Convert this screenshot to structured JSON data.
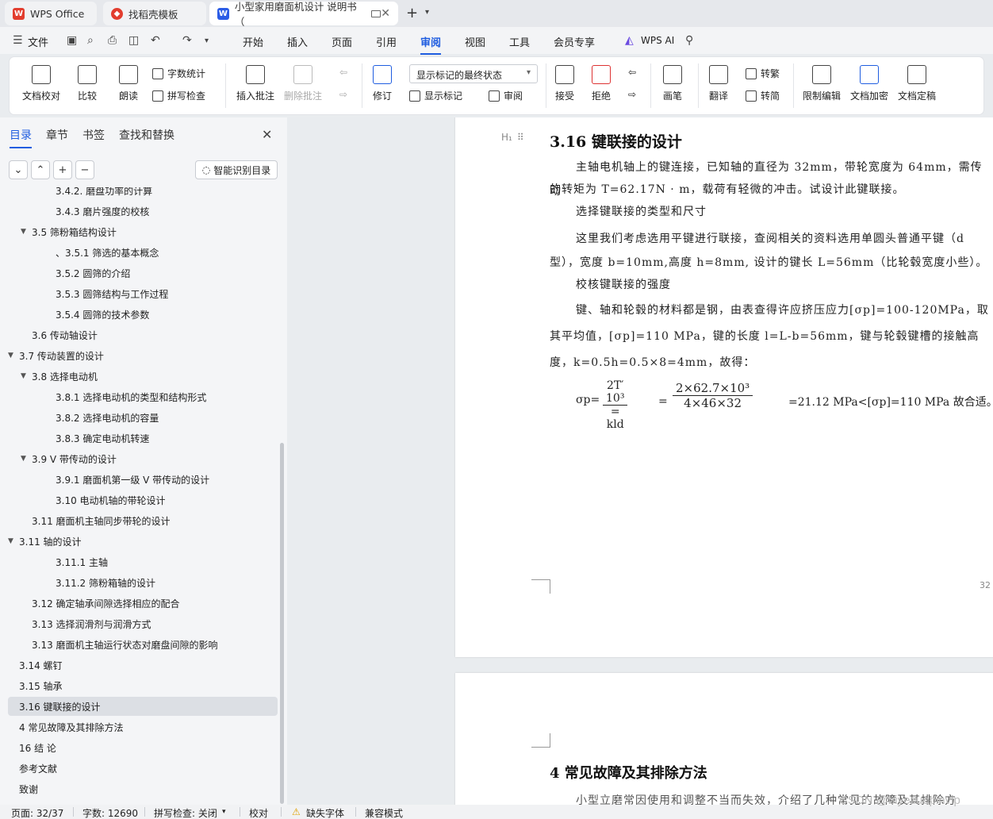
{
  "tabs": {
    "wps_office": "WPS Office",
    "template": "找稻壳模板",
    "document": "小型家用磨面机设计 说明书（"
  },
  "menu": {
    "file": "文件",
    "start": "开始",
    "insert": "插入",
    "page": "页面",
    "cite": "引用",
    "review": "审阅",
    "view": "视图",
    "tools": "工具",
    "member": "会员专享",
    "wps_ai": "WPS AI"
  },
  "ribbon": {
    "doc_check": "文档校对",
    "compare": "比较",
    "read": "朗读",
    "word_count": "字数统计",
    "spell_check": "拼写检查",
    "insert_comment": "插入批注",
    "delete_comment": "删除批注",
    "revise": "修订",
    "display_mode": "显示标记的最终状态",
    "show_marks": "显示标记",
    "review_pane": "审阅",
    "accept": "接受",
    "reject": "拒绝",
    "pen": "画笔",
    "translate": "翻译",
    "to_traditional": "转繁",
    "to_simplified": "转简",
    "restrict_edit": "限制编辑",
    "encrypt": "文档加密",
    "finalize": "文档定稿"
  },
  "panel": {
    "tabs": [
      "目录",
      "章节",
      "书签",
      "查找和替换"
    ],
    "smart_toc": "智能识别目录",
    "toc": [
      {
        "label": "3.4.2. 磨盘功率的计算",
        "level": 3
      },
      {
        "label": "3.4.3 磨片强度的校核",
        "level": 3
      },
      {
        "label": "3.5  筛粉箱结构设计",
        "level": 2,
        "expanded": true
      },
      {
        "label": "、3.5.1  筛选的基本概念",
        "level": 3
      },
      {
        "label": "3.5.2 圆筛的介绍",
        "level": 3
      },
      {
        "label": "3.5.3  圆筛结构与工作过程",
        "level": 3
      },
      {
        "label": "3.5.4  圆筛的技术参数",
        "level": 3
      },
      {
        "label": "3.6  传动轴设计",
        "level": 2
      },
      {
        "label": "3.7  传动装置的设计",
        "level": 1,
        "expanded": true
      },
      {
        "label": "3.8  选择电动机",
        "level": 2,
        "expanded": true
      },
      {
        "label": "3.8.1  选择电动机的类型和结构形式",
        "level": 3
      },
      {
        "label": "3.8.2  选择电动机的容量",
        "level": 3
      },
      {
        "label": "3.8.3  确定电动机转速",
        "level": 3
      },
      {
        "label": "3.9 V 带传动的设计",
        "level": 2,
        "expanded": true
      },
      {
        "label": "3.9.1  磨面机第一级 V 带传动的设计",
        "level": 3
      },
      {
        "label": "3.10 电动机轴的带轮设计",
        "level": 3
      },
      {
        "label": "3.11  磨面机主轴同步带轮的设计",
        "level": 2
      },
      {
        "label": "3.11  轴的设计",
        "level": 1,
        "expanded": true
      },
      {
        "label": "3.11.1  主轴",
        "level": 3
      },
      {
        "label": "3.11.2  筛粉箱轴的设计",
        "level": 3
      },
      {
        "label": "3.12  确定轴承间隙选择相应的配合",
        "level": 2
      },
      {
        "label": "3.13 选择润滑剂与润滑方式",
        "level": 2
      },
      {
        "label": "3.13  磨面机主轴运行状态对磨盘间隙的影响",
        "level": 2
      },
      {
        "label": "3.14  螺钉",
        "level": 1
      },
      {
        "label": "3.15 轴承",
        "level": 1
      },
      {
        "label": "3.16    键联接的设计",
        "level": 1,
        "selected": true
      },
      {
        "label": "4  常见故障及其排除方法",
        "level": 1
      },
      {
        "label": "16  结  论",
        "level": 1
      },
      {
        "label": "参考文献",
        "level": 1
      },
      {
        "label": "致谢",
        "level": 1
      }
    ]
  },
  "document": {
    "heading": "3.16   键联接的设计",
    "para1_line1": "主轴电机轴上的键连接，已知轴的直径为 32mm，带轮宽度为 64mm，需传动",
    "para1_line2": "的转矩为 T=62.17N · m，载荷有轻微的冲击。试设计此键联接。",
    "para2": "选择键联接的类型和尺寸",
    "para3_line1": "这里我们考虑选用平键进行联接，查阅相关的资料选用单圆头普通平键（d",
    "para3_line2": "型），宽度 b=10mm,高度 h=8mm, 设计的键长 L=56mm（比轮毂宽度小些）。",
    "para4": "校核键联接的强度",
    "para5_line1": "键、轴和轮毂的材料都是钢，由表查得许应挤压应力[σp]=100-120MPa，取",
    "para5_line2": "其平均值，[σp]=110 MPa，键的长度 l=L-b=56mm，键与轮毂键槽的接触高",
    "para5_line3": "度，k=0.5h=0.5×8=4mm，故得：",
    "formula_lhs": "σp=",
    "formula_num1": "2T′ 10³",
    "formula_den1": "= kld",
    "formula_eq": "=",
    "formula_num2": "2×62.7×10³",
    "formula_den2": "4×46×32",
    "formula_result": "=21.12 MPa<[σp]=110 MPa 故合适。",
    "page_number": "32",
    "heading2": "4  常见故障及其排除方法",
    "para_next": "小型立磨常因使用和调整不当而失效，介绍了几种常见的故障及其排除方"
  },
  "status": {
    "page": "页面: 32/37",
    "words": "字数: 12690",
    "spell": "拼写检查: 关闭",
    "proof": "校对",
    "missing_font": "缺失字体",
    "compat": "兼容模式"
  },
  "watermark": "CSDN @biyezuopinvip",
  "colors": {
    "accent": "#1f5de0",
    "wps_red": "#e23d2e",
    "selected_row": "#dcdfe4"
  }
}
